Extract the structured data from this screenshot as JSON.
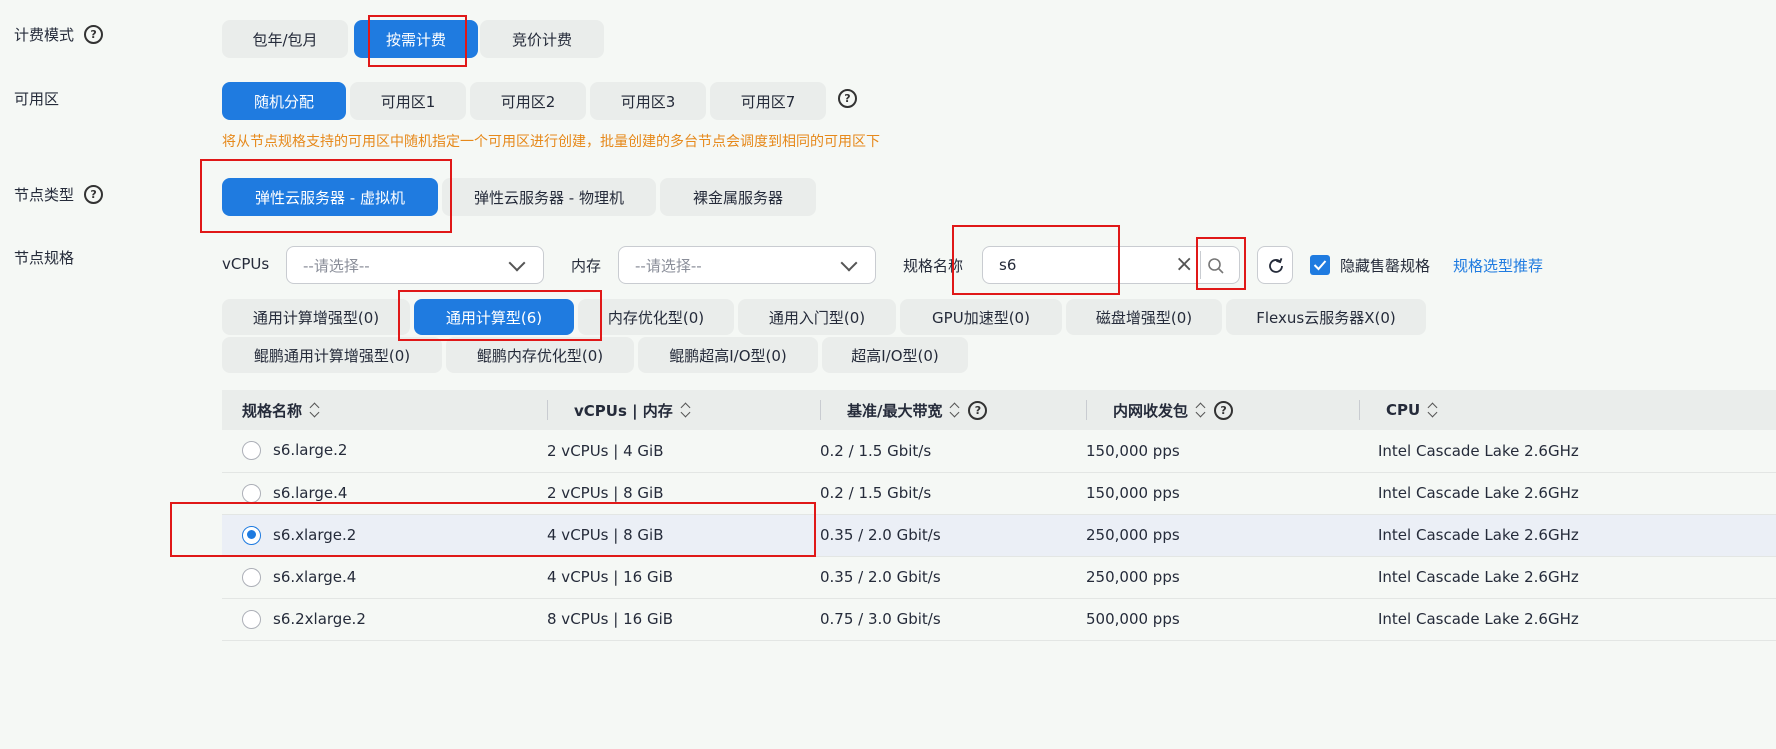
{
  "billing": {
    "label": "计费模式",
    "options": [
      "包年/包月",
      "按需计费",
      "竞价计费"
    ],
    "selected": "按需计费"
  },
  "az": {
    "label": "可用区",
    "options": [
      "随机分配",
      "可用区1",
      "可用区2",
      "可用区3",
      "可用区7"
    ],
    "selected": "随机分配",
    "hint": "将从节点规格支持的可用区中随机指定一个可用区进行创建，批量创建的多台节点会调度到相同的可用区下"
  },
  "node_type": {
    "label": "节点类型",
    "options": [
      "弹性云服务器 - 虚拟机",
      "弹性云服务器 - 物理机",
      "裸金属服务器"
    ],
    "selected": "弹性云服务器 - 虚拟机"
  },
  "spec": {
    "label": "节点规格",
    "vcpus_label": "vCPUs",
    "vcpus_placeholder": "--请选择--",
    "mem_label": "内存",
    "mem_placeholder": "--请选择--",
    "name_label": "规格名称",
    "name_value": "s6",
    "hide_sold_out_label": "隐藏售罄规格",
    "hide_sold_out_checked": true,
    "recommend_link": "规格选型推荐"
  },
  "type_tabs": [
    "通用计算增强型(0)",
    "通用计算型(6)",
    "内存优化型(0)",
    "通用入门型(0)",
    "GPU加速型(0)",
    "磁盘增强型(0)",
    "Flexus云服务器X(0)",
    "鲲鹏通用计算增强型(0)",
    "鲲鹏内存优化型(0)",
    "鲲鹏超高I/O型(0)",
    "超高I/O型(0)"
  ],
  "active_type_tab": "通用计算型(6)",
  "table": {
    "headers": [
      "规格名称",
      "vCPUs | 内存",
      "基准/最大带宽",
      "内网收发包",
      "CPU"
    ],
    "rows": [
      [
        "s6.large.2",
        "2 vCPUs | 4 GiB",
        "0.2 / 1.5 Gbit/s",
        "150,000 pps",
        "Intel Cascade Lake 2.6GHz"
      ],
      [
        "s6.large.4",
        "2 vCPUs | 8 GiB",
        "0.2 / 1.5 Gbit/s",
        "150,000 pps",
        "Intel Cascade Lake 2.6GHz"
      ],
      [
        "s6.xlarge.2",
        "4 vCPUs | 8 GiB",
        "0.35 / 2.0 Gbit/s",
        "250,000 pps",
        "Intel Cascade Lake 2.6GHz"
      ],
      [
        "s6.xlarge.4",
        "4 vCPUs | 16 GiB",
        "0.35 / 2.0 Gbit/s",
        "250,000 pps",
        "Intel Cascade Lake 2.6GHz"
      ],
      [
        "s6.2xlarge.2",
        "8 vCPUs | 16 GiB",
        "0.75 / 3.0 Gbit/s",
        "500,000 pps",
        "Intel Cascade Lake 2.6GHz"
      ]
    ],
    "selected_row": "s6.xlarge.2"
  },
  "colors": {
    "primary": "#1f7be0",
    "hint": "#e6891b",
    "highlight": "#e01818"
  }
}
